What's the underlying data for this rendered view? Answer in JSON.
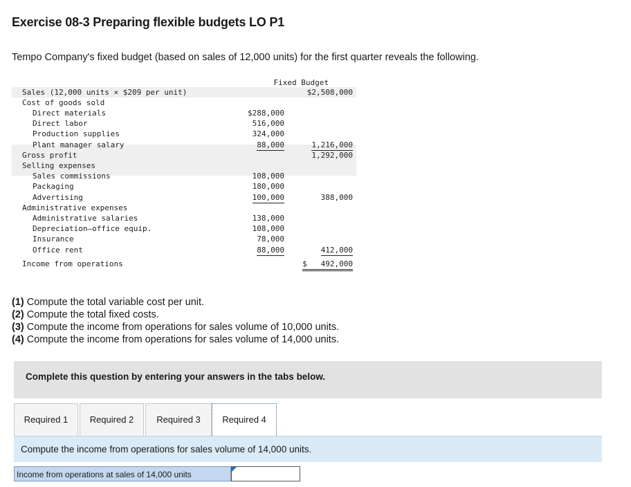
{
  "title": "Exercise 08-3 Preparing flexible budgets LO P1",
  "intro": "Tempo Company's fixed budget (based on sales of 12,000 units) for the first quarter reveals the following.",
  "budget": {
    "header": "Fixed Budget",
    "rows": [
      {
        "label": "Sales (12,000 units × $209 per unit)",
        "c1": "",
        "c2": "$2,508,000"
      },
      {
        "label": "Cost of goods sold",
        "c1": "",
        "c2": ""
      },
      {
        "label": "Direct materials",
        "c1": "$288,000",
        "c2": ""
      },
      {
        "label": "Direct labor",
        "c1": "516,000",
        "c2": ""
      },
      {
        "label": "Production supplies",
        "c1": "324,000",
        "c2": ""
      },
      {
        "label": "Plant manager salary",
        "c1": "88,000",
        "c2": "1,216,000"
      },
      {
        "label": "Gross profit",
        "c1": "",
        "c2": "1,292,000"
      },
      {
        "label": "Selling expenses",
        "c1": "",
        "c2": ""
      },
      {
        "label": "Sales commissions",
        "c1": "108,000",
        "c2": ""
      },
      {
        "label": "Packaging",
        "c1": "180,000",
        "c2": ""
      },
      {
        "label": "Advertising",
        "c1": "100,000",
        "c2": "388,000"
      },
      {
        "label": "Administrative expenses",
        "c1": "",
        "c2": ""
      },
      {
        "label": "Administrative salaries",
        "c1": "138,000",
        "c2": ""
      },
      {
        "label": "Depreciation—office equip.",
        "c1": "108,000",
        "c2": ""
      },
      {
        "label": "Insurance",
        "c1": "78,000",
        "c2": ""
      },
      {
        "label": "Office rent",
        "c1": "88,000",
        "c2": "412,000"
      },
      {
        "label": "Income from operations",
        "c1": "",
        "c2": "$   492,000"
      }
    ]
  },
  "questions": [
    {
      "num": "(1)",
      "text": " Compute the total variable cost per unit."
    },
    {
      "num": "(2)",
      "text": " Compute the total fixed costs."
    },
    {
      "num": "(3)",
      "text": " Compute the income from operations for sales volume of 10,000 units."
    },
    {
      "num": "(4)",
      "text": " Compute the income from operations for sales volume of 14,000 units."
    }
  ],
  "banner": "Complete this question by entering your answers in the tabs below.",
  "tabs": [
    {
      "label": "Required 1"
    },
    {
      "label": "Required 2"
    },
    {
      "label": "Required 3"
    },
    {
      "label": "Required 4"
    }
  ],
  "panel_text": "Compute the income from operations for sales volume of 14,000 units.",
  "answer": {
    "label": "Income from operations at sales of 14,000 units",
    "value": ""
  }
}
